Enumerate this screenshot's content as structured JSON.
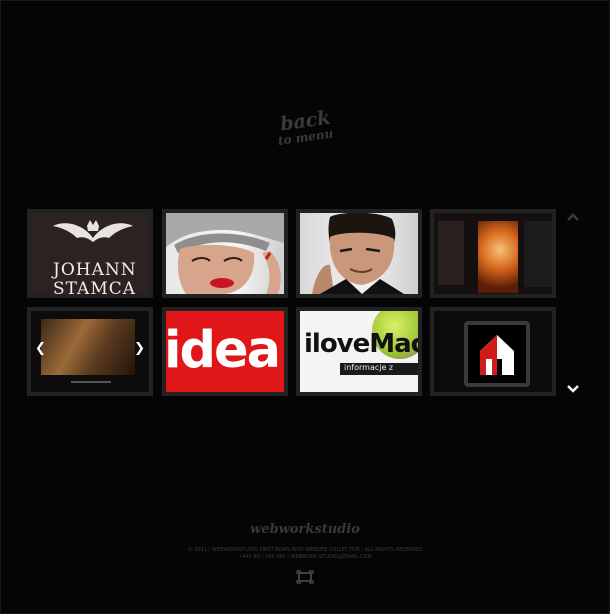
{
  "nav": {
    "back_line1": "back",
    "back_line2": "to menu",
    "scroll_up_icon": "chevron-up-icon",
    "scroll_down_icon": "chevron-down-icon"
  },
  "portfolio": {
    "tiles": [
      {
        "id": "johann",
        "title_line1": "JOHANN",
        "title_line2": "STAMCA"
      },
      {
        "id": "woman"
      },
      {
        "id": "man"
      },
      {
        "id": "poster"
      },
      {
        "id": "painting"
      },
      {
        "id": "idea",
        "text": "idea"
      },
      {
        "id": "ilove",
        "text": "iloveMac",
        "subtext": "informacje z"
      },
      {
        "id": "house"
      }
    ]
  },
  "footer": {
    "brand": "webworkstudio",
    "line1": "© 2011 / WEBWORKSTUDIO FIRST BORN INTO WEBSITE COLLECTIVE / ALL RIGHTS RESERVED",
    "line2": "+441 60 / 999 999 / WEBWORK.STUDIO@EMAIL.COM",
    "fullscreen_icon": "fullscreen-icon"
  },
  "colors": {
    "background": "#050505",
    "tile_border": "#222222",
    "accent_red": "#e01618"
  }
}
